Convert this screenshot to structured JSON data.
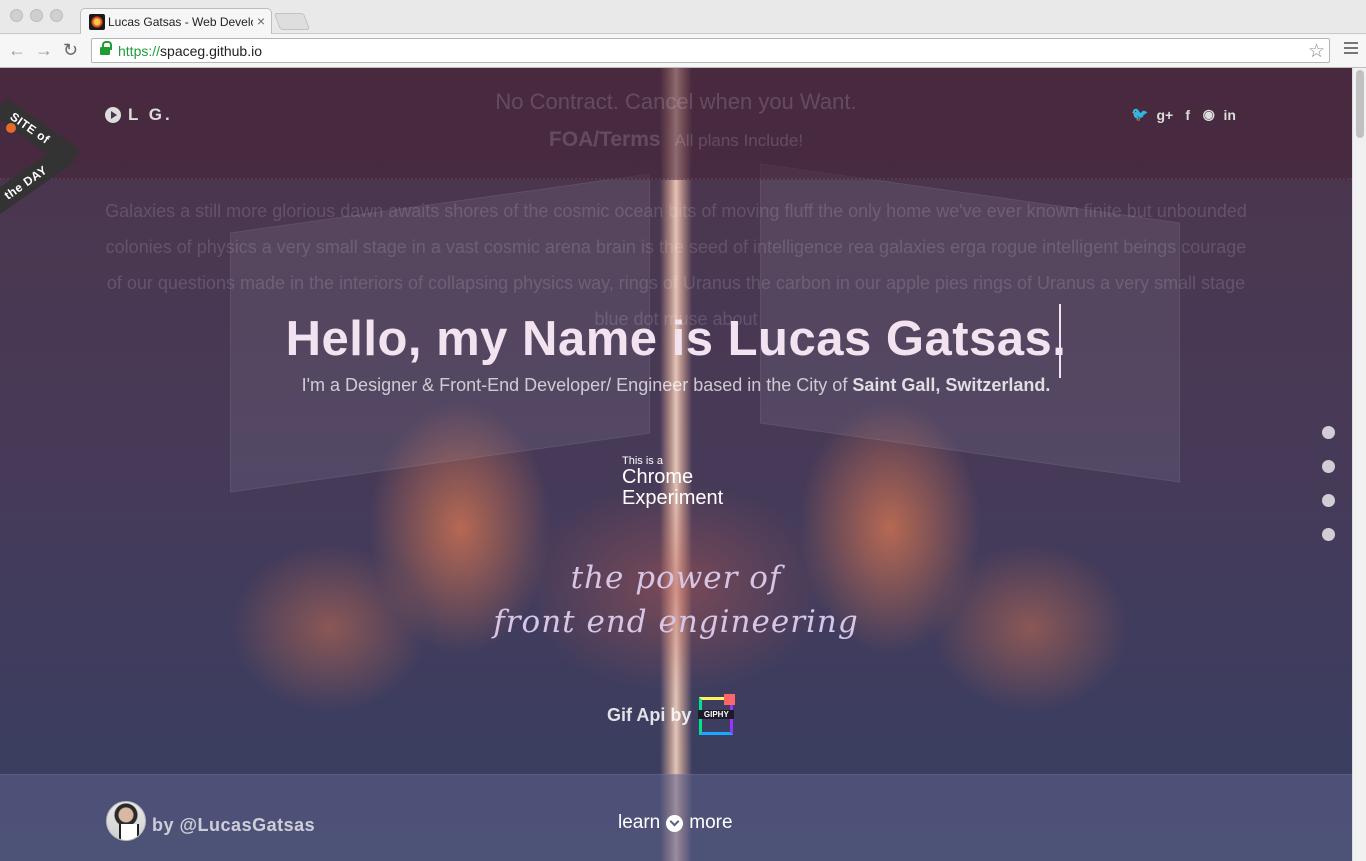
{
  "browser": {
    "tab": {
      "title": "Lucas Gatsas - Web Developer",
      "close": "×"
    },
    "url": {
      "scheme": "https://",
      "host": "spaceg.github.io"
    },
    "icons": {
      "back": "←",
      "forward": "→",
      "reload": "↻",
      "star": "☆"
    }
  },
  "site": {
    "logo": "L G.",
    "socials": [
      "twitter",
      "google-plus",
      "facebook",
      "github",
      "linkedin"
    ],
    "social_glyphs": {
      "twitter": "🐦",
      "google-plus": "g+",
      "facebook": "f",
      "github": "◉",
      "linkedin": "in"
    },
    "ribbon": {
      "line1": "SITE of",
      "line2": "the DAY"
    },
    "ghost": {
      "title": "No Contract. Cancel when you Want.",
      "sub_bold": "FOA/Terms",
      "sub": "All plans Include!",
      "paragraph": "Galaxies a still more glorious dawn awaits shores of the cosmic ocean bits of moving fluff the only home we've ever known finite but unbounded colonies of physics a very small stage in a vast cosmic arena brain is the seed of intelligence rea galaxies erga rogue intelligent beings courage of our questions made in the interiors of collapsing physics way, rings of Uranus the carbon in our apple pies rings of Uranus a very small stage blue dot muse about"
    },
    "hero": {
      "title": "Hello, my Name is Lucas Gatsas.",
      "subtitle_prefix": "I'm a Designer & Front-End Developer/ Engineer based in the City of ",
      "subtitle_bold": "Saint Gall, Switzerland."
    },
    "chrome_experiment": {
      "small": "This is a",
      "line1": "Chrome",
      "line2": "Experiment"
    },
    "tagline": {
      "line1": "the power of",
      "line2": "front end engineering"
    },
    "giphy": {
      "label": "Gif Api by",
      "logo_word": "GIPHY"
    },
    "nav_dots": 4,
    "footer": {
      "byline": "by @LucasGatsas",
      "learn_left": "learn",
      "learn_right": "more"
    }
  }
}
